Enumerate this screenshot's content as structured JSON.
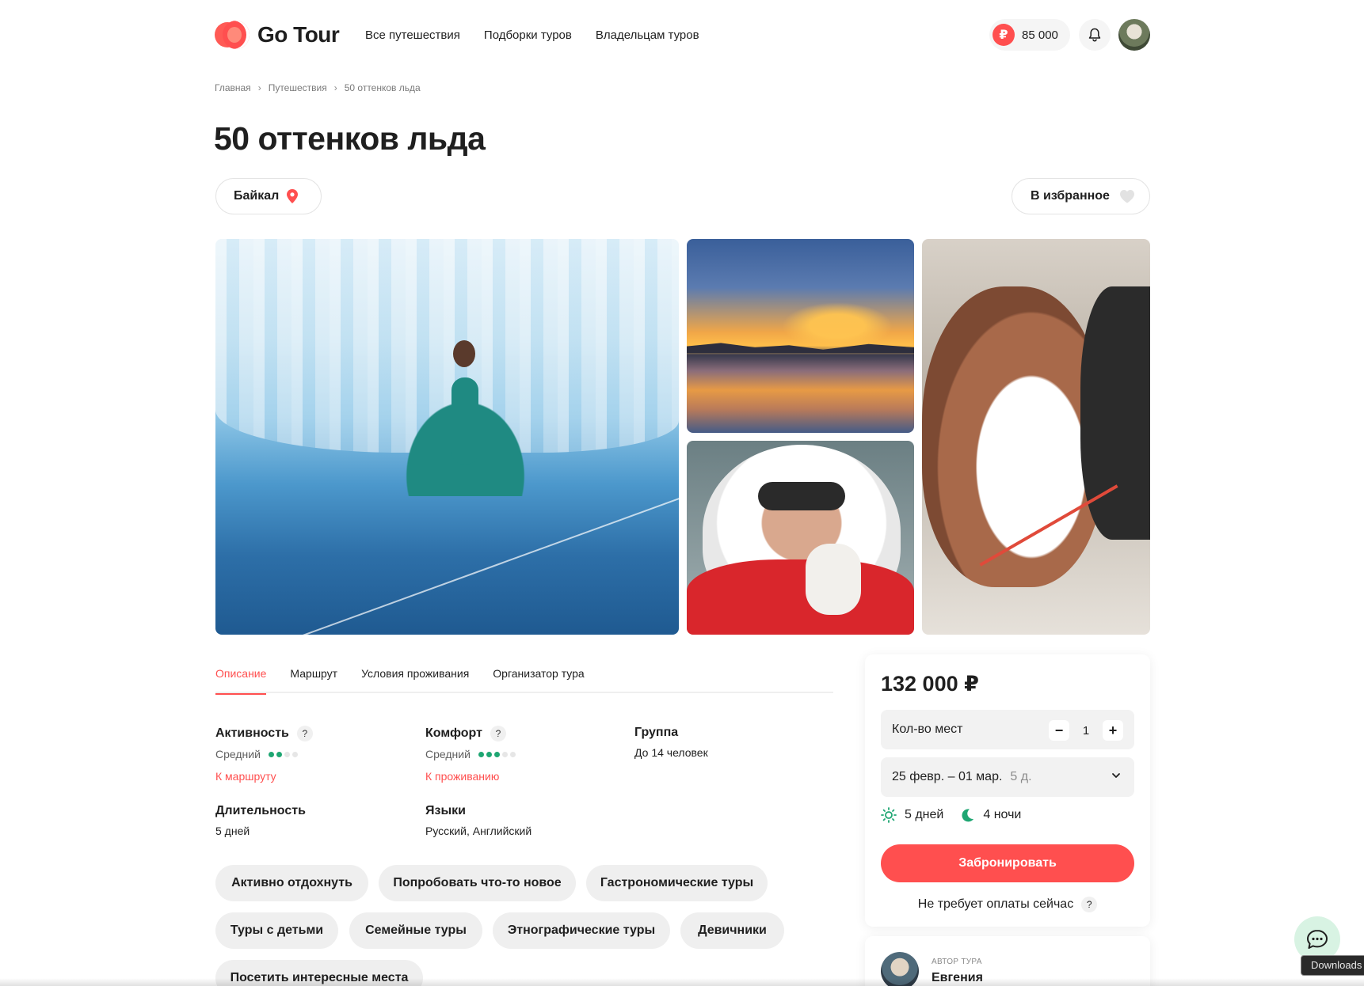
{
  "header": {
    "logo_text": "Go Tour",
    "nav": [
      "Все путешествия",
      "Подборки туров",
      "Владельцам туров"
    ],
    "balance": "85 000",
    "balance_currency_icon": "ruble-icon",
    "bell_icon": "bell-icon"
  },
  "breadcrumb": [
    "Главная",
    "Путешествия",
    "50 оттенков льда"
  ],
  "title": "50 оттенков льда",
  "location": "Байкал",
  "favorite_label": "В избранное",
  "tabs": [
    "Описание",
    "Маршрут",
    "Условия проживания",
    "Организатор тура"
  ],
  "active_tab": "Описание",
  "characteristics": {
    "activity": {
      "label": "Активность",
      "help": "?",
      "value": "Средний",
      "level": 2,
      "max": 4,
      "link": "К маршруту"
    },
    "comfort": {
      "label": "Комфорт",
      "help": "?",
      "value": "Средний",
      "level": 3,
      "max": 5,
      "link": "К проживанию"
    },
    "group": {
      "label": "Группа",
      "value": "До 14 человек"
    },
    "duration": {
      "label": "Длительность",
      "value": "5 дней"
    },
    "languages": {
      "label": "Языки",
      "value": "Русский, Английский"
    }
  },
  "chips": [
    "Активно отдохнуть",
    "Попробовать что-то новое",
    "Гастрономические туры",
    "Туры с детьми",
    "Семейные туры",
    "Этнографические туры",
    "Девичники",
    "Посетить интересные места"
  ],
  "booking": {
    "price": "132 000 ₽",
    "seats_label": "Кол-во мест",
    "seats_value": "1",
    "minus": "−",
    "plus": "+",
    "dates": "25 февр. – 01 мар.",
    "dates_days": "5 д.",
    "days": "5 дней",
    "nights": "4 ночи",
    "book_button": "Забронировать",
    "no_payment": "Не требует оплаты сейчас",
    "no_payment_help": "?"
  },
  "author": {
    "caption": "АВТОР ТУРА",
    "name": "Евгения"
  },
  "tooltip": "Downloads",
  "colors": {
    "accent": "#ff4f4f",
    "level_on": "#1ea672",
    "level_off": "#e6e6e6"
  }
}
